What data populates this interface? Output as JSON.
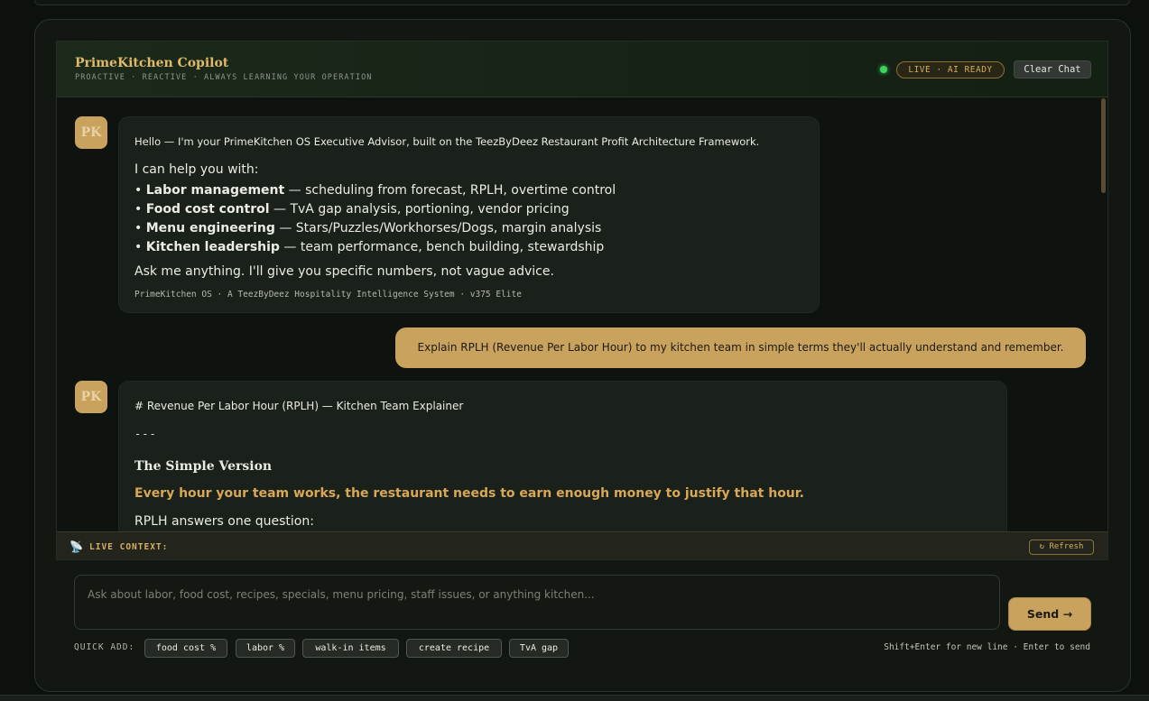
{
  "header": {
    "title": "PrimeKitchen Copilot",
    "subtitle": "PROACTIVE · REACTIVE · ALWAYS LEARNING YOUR OPERATION",
    "status_badge": "LIVE · AI READY",
    "clear_label": "Clear Chat"
  },
  "messages": {
    "welcome": {
      "avatar": "PK",
      "intro": "Hello — I'm your PrimeKitchen OS Executive Advisor, built on the TeezByDeez Restaurant Profit Architecture Framework.",
      "lead": "I can help you with:",
      "items": [
        {
          "bullet": "• ",
          "title": "Labor management",
          "desc": " — scheduling from forecast, RPLH, overtime control"
        },
        {
          "bullet": "• ",
          "title": "Food cost control",
          "desc": " — TvA gap analysis, portioning, vendor pricing"
        },
        {
          "bullet": "• ",
          "title": "Menu engineering",
          "desc": " — Stars/Puzzles/Workhorses/Dogs, margin analysis"
        },
        {
          "bullet": "• ",
          "title": "Kitchen leadership",
          "desc": " — team performance, bench building, stewardship"
        }
      ],
      "ask": "Ask me anything. I'll give you specific numbers, not vague advice.",
      "footer": "PrimeKitchen OS · A TeezByDeez Hospitality Intelligence System · v375 Elite"
    },
    "user": {
      "text": "Explain RPLH (Revenue Per Labor Hour) to my kitchen team in simple terms they'll actually understand and remember."
    },
    "reply": {
      "avatar": "PK",
      "heading": "# Revenue Per Labor Hour (RPLH) — Kitchen Team Explainer",
      "rule": "---",
      "subheading": "The Simple Version",
      "highlight": "Every hour your team works, the restaurant needs to earn enough money to justify that hour.",
      "paragraph": "RPLH answers one question:"
    }
  },
  "context": {
    "icon": "📡",
    "label": "LIVE CONTEXT:",
    "refresh_label": "↻ Refresh"
  },
  "composer": {
    "placeholder": "Ask about labor, food cost, recipes, specials, menu pricing, staff issues, or anything kitchen...",
    "send_label": "Send →",
    "quick_label": "QUICK ADD:",
    "chips": [
      "food cost %",
      "labor %",
      "walk-in items",
      "create recipe",
      "TvA gap"
    ],
    "hint": "Shift+Enter for new line · Enter to send"
  },
  "colors": {
    "accent": "#c9a25d",
    "live": "#3dd45a",
    "background": "#0d110e"
  }
}
